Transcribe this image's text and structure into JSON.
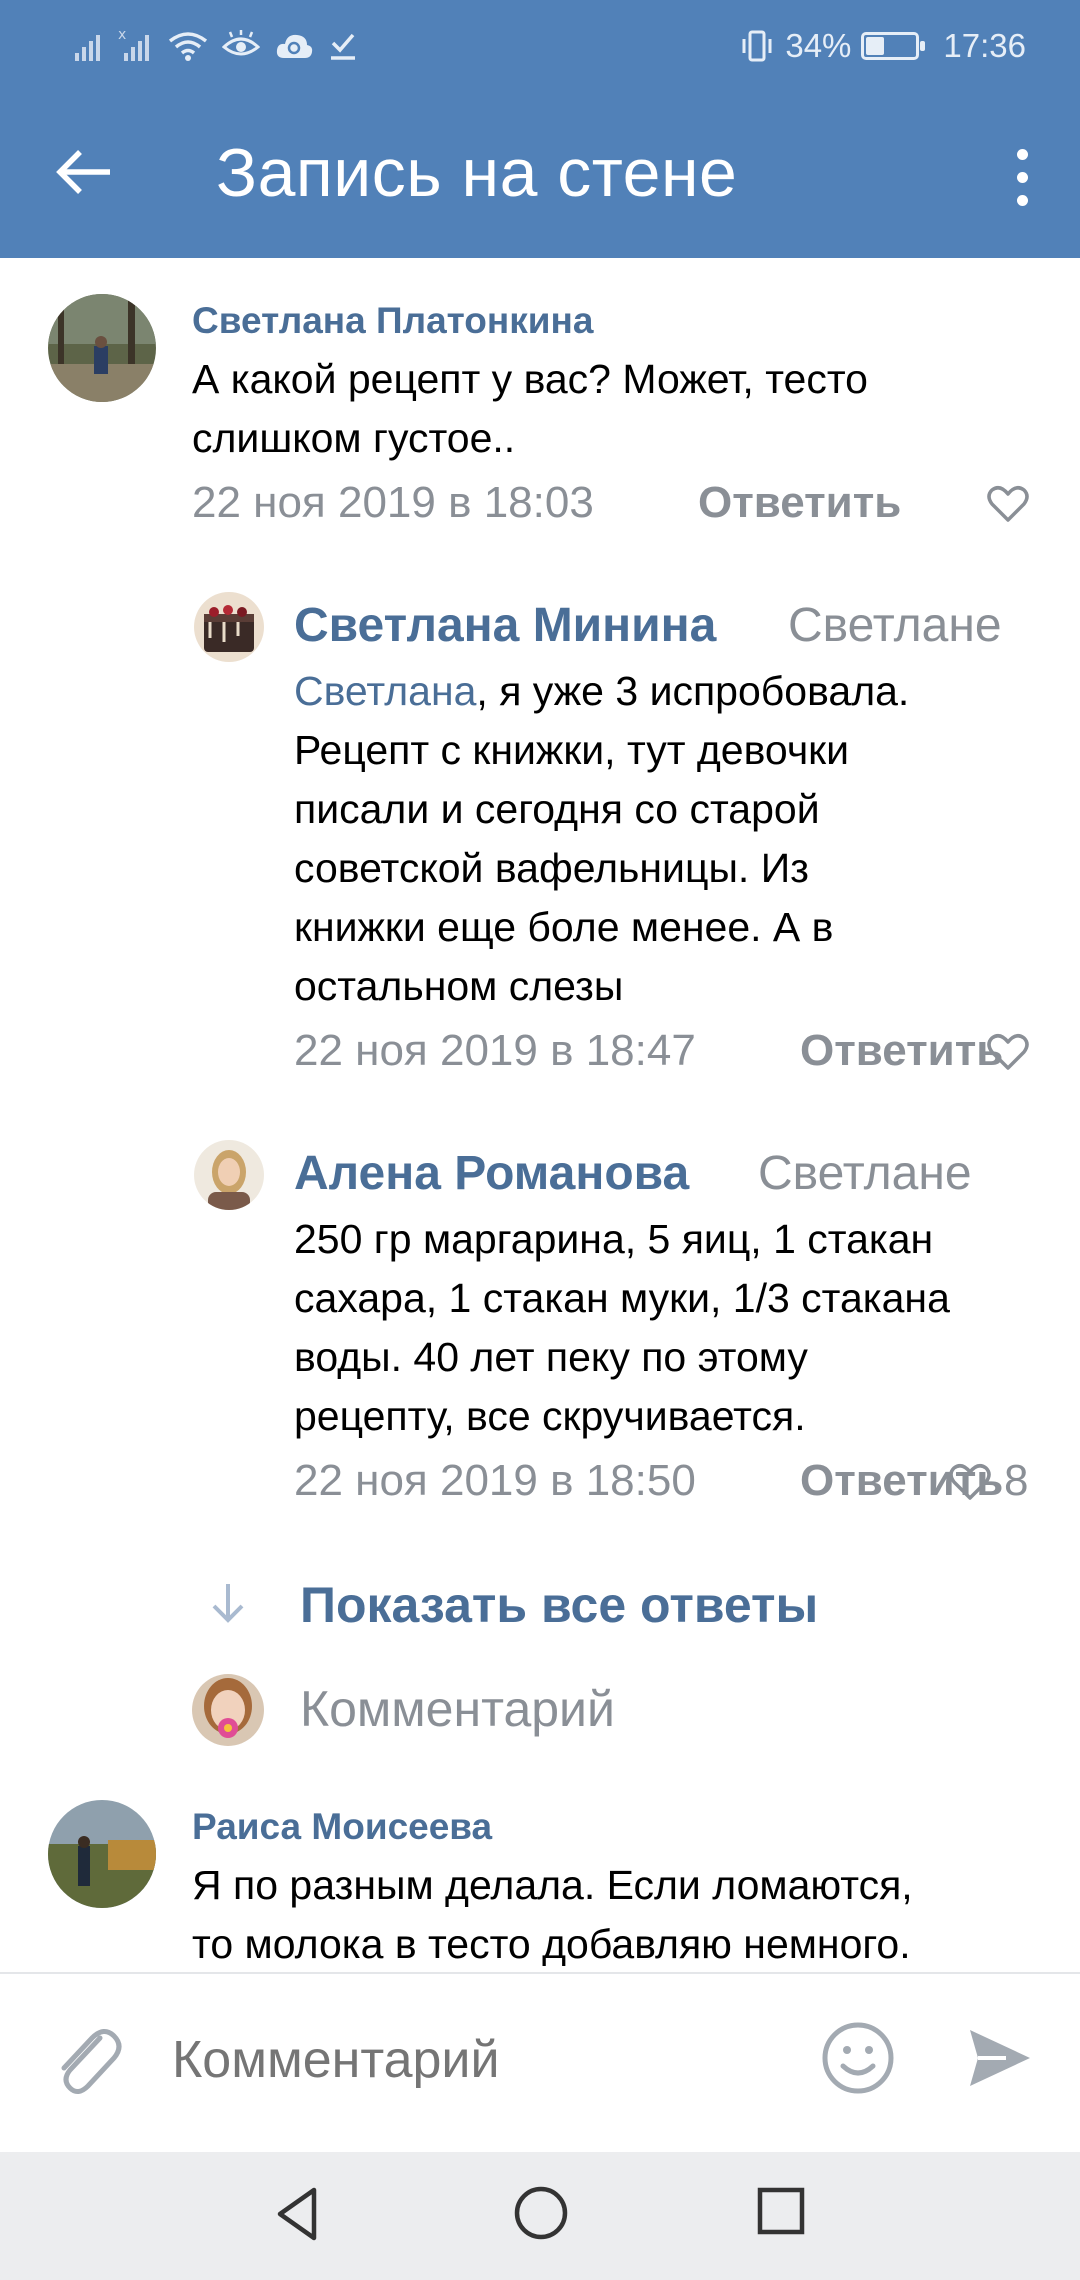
{
  "status_bar": {
    "battery_percent": "34%",
    "battery_level": 0.34,
    "time": "17:36",
    "icons": [
      "signal-icon",
      "signal-no-sim-icon",
      "wifi-icon",
      "eye-icon",
      "cloud-sync-icon",
      "download-done-icon",
      "vibrate-icon"
    ]
  },
  "header": {
    "title": "Запись на стене",
    "back_icon": "arrow-left-icon",
    "more_icon": "more-vertical-icon",
    "color": "#5181b8"
  },
  "comments": [
    {
      "author": "Светлана Платонкина",
      "lines": [
        "А какой рецепт у вас? Может, тесто",
        "слишком густое.."
      ],
      "date": "22 ноя 2019 в 18:03",
      "reply_label": "Ответить"
    },
    {
      "author": "Светлана Минина",
      "reply_to": "Светлане",
      "mention": "Светлана",
      "lines": [
        ", я уже 3 испробовала.",
        "Рецепт с книжки, тут девочки",
        "писали и сегодня со старой",
        "советской вафельницы. Из",
        "книжки еще боле менее. А в",
        "остальном слезы"
      ],
      "date": "22 ноя 2019 в 18:47",
      "reply_label": "Ответить"
    },
    {
      "author": "Алена Романова",
      "reply_to": "Светлане",
      "lines": [
        "250 гр маргарина, 5 яиц, 1 стакан",
        "сахара, 1 стакан муки, 1/3 стакана",
        "воды. 40 лет пеку по этому",
        "рецепту, все скручивается."
      ],
      "date": "22 ноя 2019 в 18:50",
      "reply_label": "Ответить",
      "likes": "8"
    },
    {
      "author": "Раиса Моисеева",
      "lines": [
        "Я по разным делала. Если ломаются,",
        "то молока в тесто добавляю немного."
      ]
    }
  ],
  "thread": {
    "show_all_label": "Показать все ответы",
    "inline_comment_placeholder": "Комментарий"
  },
  "composer": {
    "placeholder": "Комментарий",
    "attach_icon": "paperclip-icon",
    "emoji_icon": "emoji-icon",
    "send_icon": "send-icon"
  },
  "nav_bar": {
    "icons": [
      "nav-back-icon",
      "nav-home-icon",
      "nav-recents-icon"
    ]
  },
  "colors": {
    "accent": "#5181b8",
    "link": "#4a6e97",
    "secondary_text": "#8a8f96"
  }
}
